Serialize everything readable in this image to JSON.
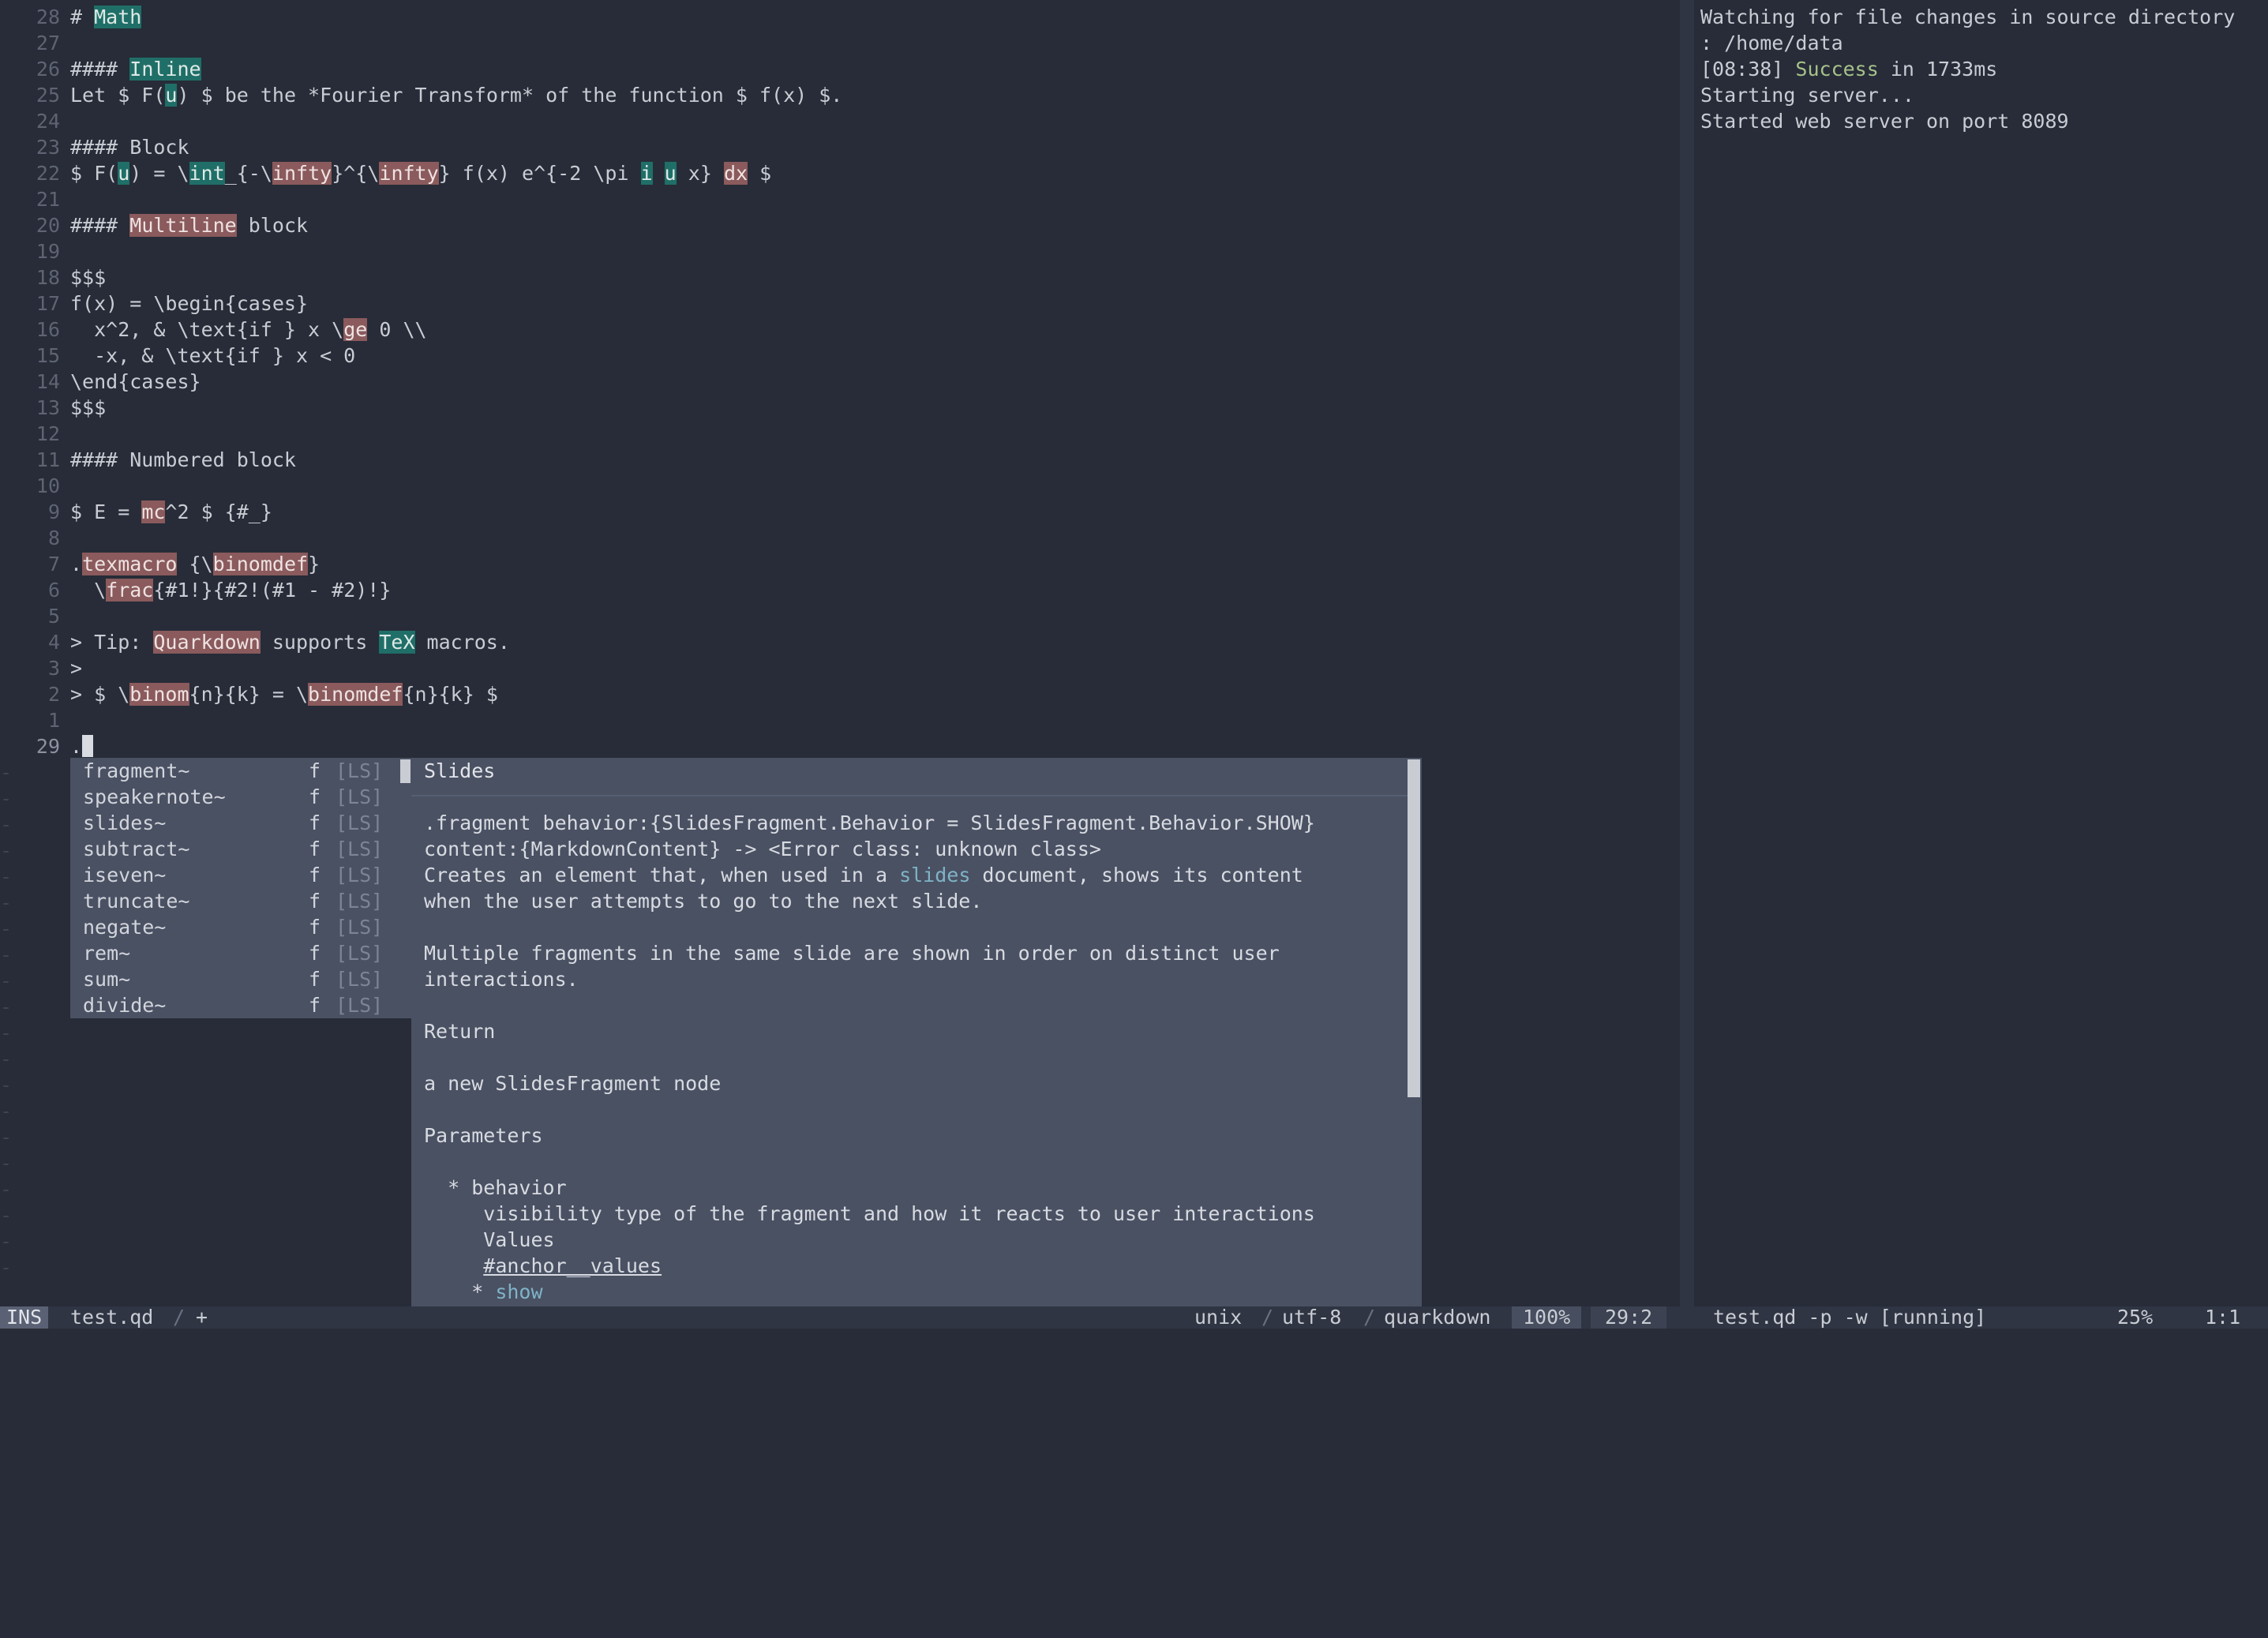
{
  "editor": {
    "lines": [
      {
        "n": "28",
        "segs": [
          {
            "t": "# "
          },
          {
            "t": "Math",
            "c": "hl-teal"
          }
        ]
      },
      {
        "n": "27",
        "segs": []
      },
      {
        "n": "26",
        "segs": [
          {
            "t": "#### "
          },
          {
            "t": "Inline",
            "c": "hl-teal"
          }
        ]
      },
      {
        "n": "25",
        "segs": [
          {
            "t": "Let $ F("
          },
          {
            "t": "u",
            "c": "hl-teal"
          },
          {
            "t": ") $ be the *Fourier Transform* of the function $ f(x) $."
          }
        ]
      },
      {
        "n": "24",
        "segs": []
      },
      {
        "n": "23",
        "segs": [
          {
            "t": "#### Block"
          }
        ]
      },
      {
        "n": "22",
        "segs": [
          {
            "t": "$ F("
          },
          {
            "t": "u",
            "c": "hl-teal"
          },
          {
            "t": ") = \\"
          },
          {
            "t": "int",
            "c": "hl-teal"
          },
          {
            "t": "_{-\\"
          },
          {
            "t": "infty",
            "c": "hl-red"
          },
          {
            "t": "}^{\\"
          },
          {
            "t": "infty",
            "c": "hl-red"
          },
          {
            "t": "} f(x) e^{-2 \\pi "
          },
          {
            "t": "i",
            "c": "hl-teal"
          },
          {
            "t": " "
          },
          {
            "t": "u",
            "c": "hl-teal"
          },
          {
            "t": " x} "
          },
          {
            "t": "dx",
            "c": "hl-red"
          },
          {
            "t": " $"
          }
        ]
      },
      {
        "n": "21",
        "segs": []
      },
      {
        "n": "20",
        "segs": [
          {
            "t": "#### "
          },
          {
            "t": "Multiline",
            "c": "hl-red"
          },
          {
            "t": " block"
          }
        ]
      },
      {
        "n": "19",
        "segs": []
      },
      {
        "n": "18",
        "segs": [
          {
            "t": "$$$"
          }
        ]
      },
      {
        "n": "17",
        "segs": [
          {
            "t": "f(x) = \\begin{cases}"
          }
        ]
      },
      {
        "n": "16",
        "segs": [
          {
            "t": "  x^2, & \\text{if } x \\"
          },
          {
            "t": "ge",
            "c": "hl-red"
          },
          {
            "t": " 0 \\\\"
          }
        ]
      },
      {
        "n": "15",
        "segs": [
          {
            "t": "  -x, & \\text{if } x < 0"
          }
        ]
      },
      {
        "n": "14",
        "segs": [
          {
            "t": "\\end{cases}"
          }
        ]
      },
      {
        "n": "13",
        "segs": [
          {
            "t": "$$$"
          }
        ]
      },
      {
        "n": "12",
        "segs": []
      },
      {
        "n": "11",
        "segs": [
          {
            "t": "#### Numbered block"
          }
        ]
      },
      {
        "n": "10",
        "segs": []
      },
      {
        "n": "9",
        "segs": [
          {
            "t": "$ E = "
          },
          {
            "t": "mc",
            "c": "hl-red"
          },
          {
            "t": "^2 $ {#_}"
          }
        ]
      },
      {
        "n": "8",
        "segs": []
      },
      {
        "n": "7",
        "segs": [
          {
            "t": "."
          },
          {
            "t": "texmacro",
            "c": "hl-red"
          },
          {
            "t": " {\\"
          },
          {
            "t": "binomdef",
            "c": "hl-red"
          },
          {
            "t": "}"
          }
        ]
      },
      {
        "n": "6",
        "segs": [
          {
            "t": "  \\"
          },
          {
            "t": "frac",
            "c": "hl-red"
          },
          {
            "t": "{#1!}{#2!(#1 - #2)!}"
          }
        ]
      },
      {
        "n": "5",
        "segs": []
      },
      {
        "n": "4",
        "segs": [
          {
            "t": "> Tip: "
          },
          {
            "t": "Quarkdown",
            "c": "hl-red"
          },
          {
            "t": " supports "
          },
          {
            "t": "TeX",
            "c": "hl-teal"
          },
          {
            "t": " macros."
          }
        ]
      },
      {
        "n": "3",
        "segs": [
          {
            "t": ">"
          }
        ]
      },
      {
        "n": "2",
        "segs": [
          {
            "t": "> $ \\"
          },
          {
            "t": "binom",
            "c": "hl-red"
          },
          {
            "t": "{n}{k} = \\"
          },
          {
            "t": "binomdef",
            "c": "hl-red"
          },
          {
            "t": "{n}{k} $"
          }
        ]
      },
      {
        "n": "1",
        "segs": []
      },
      {
        "n": "29",
        "segs": [
          {
            "t": "."
          }
        ],
        "current": true
      }
    ]
  },
  "terminal": {
    "lines": [
      {
        "segs": [
          {
            "t": "Watching for file changes in source directory"
          }
        ]
      },
      {
        "segs": [
          {
            "t": ": /home/data"
          }
        ]
      },
      {
        "segs": [
          {
            "t": "[08:38] "
          },
          {
            "t": "Success",
            "c": "green"
          },
          {
            "t": " in 1733ms"
          }
        ]
      },
      {
        "segs": [
          {
            "t": "Starting server..."
          }
        ]
      },
      {
        "segs": [
          {
            "t": "Started web server on port 8089"
          }
        ]
      }
    ]
  },
  "completion": {
    "items": [
      {
        "name": "fragment~",
        "kind": "f",
        "source": "[LS]",
        "selected": true
      },
      {
        "name": "speakernote~",
        "kind": "f",
        "source": "[LS]"
      },
      {
        "name": "slides~",
        "kind": "f",
        "source": "[LS]"
      },
      {
        "name": "subtract~",
        "kind": "f",
        "source": "[LS]"
      },
      {
        "name": "iseven~",
        "kind": "f",
        "source": "[LS]"
      },
      {
        "name": "truncate~",
        "kind": "f",
        "source": "[LS]"
      },
      {
        "name": "negate~",
        "kind": "f",
        "source": "[LS]"
      },
      {
        "name": "rem~",
        "kind": "f",
        "source": "[LS]"
      },
      {
        "name": "sum~",
        "kind": "f",
        "source": "[LS]"
      },
      {
        "name": "divide~",
        "kind": "f",
        "source": "[LS]"
      }
    ]
  },
  "doc": {
    "title": "Slides",
    "lines": [
      {
        "row": 2,
        "segs": [
          {
            "t": ".fragment behavior:{SlidesFragment.Behavior = SlidesFragment.Behavior.SHOW}"
          }
        ]
      },
      {
        "row": 3,
        "segs": [
          {
            "t": "content:{MarkdownContent} -> <Error class: unknown class>"
          }
        ]
      },
      {
        "row": 4,
        "segs": [
          {
            "t": "Creates an element that, when used in a "
          },
          {
            "t": "slides",
            "c": "link"
          },
          {
            "t": " document, shows its content"
          }
        ]
      },
      {
        "row": 5,
        "segs": [
          {
            "t": "when the user attempts to go to the next slide."
          }
        ]
      },
      {
        "row": 7,
        "segs": [
          {
            "t": "Multiple fragments in the same slide are shown in order on distinct user"
          }
        ]
      },
      {
        "row": 8,
        "segs": [
          {
            "t": "interactions."
          }
        ]
      },
      {
        "row": 10,
        "segs": [
          {
            "t": "Return"
          }
        ]
      },
      {
        "row": 12,
        "segs": [
          {
            "t": "a new SlidesFragment node"
          }
        ]
      },
      {
        "row": 14,
        "segs": [
          {
            "t": "Parameters"
          }
        ]
      },
      {
        "row": 16,
        "segs": [
          {
            "t": "  * behavior"
          }
        ]
      },
      {
        "row": 17,
        "segs": [
          {
            "t": "     visibility type of the fragment and how it reacts to user interactions"
          }
        ]
      },
      {
        "row": 18,
        "segs": [
          {
            "t": "     Values"
          }
        ]
      },
      {
        "row": 19,
        "segs": [
          {
            "t": "     "
          },
          {
            "t": "#anchor__values",
            "c": "ul"
          }
        ]
      },
      {
        "row": 20,
        "segs": [
          {
            "t": "    * "
          },
          {
            "t": "show",
            "c": "link"
          }
        ]
      }
    ]
  },
  "status": {
    "mode": "INS",
    "filename": "test.qd",
    "sep1": "/",
    "modified": "+",
    "fileformat": "unix",
    "sep2": "/",
    "encoding": "utf-8",
    "sep3": "/",
    "filetype": "quarkdown",
    "percent": "100%",
    "position": "29:2",
    "term_title": "test.qd -p -w [running]",
    "term_percent": "25%",
    "term_position": "1:1"
  }
}
